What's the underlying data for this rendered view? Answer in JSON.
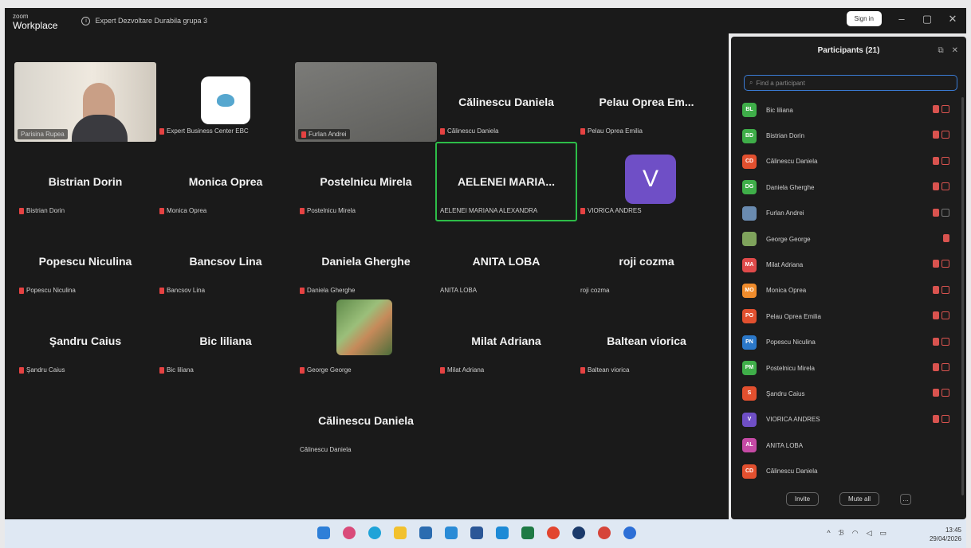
{
  "titlebar": {
    "brand_top": "zoom",
    "brand_bottom": "Workplace",
    "meeting_title": "Expert Dezvoltare Durabila grupa 3",
    "signin_label": "Sign in"
  },
  "tiles": [
    {
      "id": "t1",
      "label": "Parisina Rupea",
      "kind": "video"
    },
    {
      "id": "t2",
      "label": "Expert Business Center EBC",
      "kind": "logo"
    },
    {
      "id": "t3",
      "label": "Furlan Andrei",
      "kind": "video-gray"
    },
    {
      "id": "t4",
      "label": "Călinescu Daniela",
      "name": "Călinescu Daniela"
    },
    {
      "id": "t5",
      "label": "Pelau Oprea Emilia",
      "name": "Pelau Oprea Em..."
    },
    {
      "id": "t6",
      "label": "Bistrian Dorin",
      "name": "Bistrian Dorin"
    },
    {
      "id": "t7",
      "label": "Monica Oprea",
      "name": "Monica Oprea"
    },
    {
      "id": "t8",
      "label": "Postelnicu Mirela",
      "name": "Postelnicu Mirela"
    },
    {
      "id": "t9",
      "label": "AELENEI MARIANA ALEXANDRA",
      "name": "AELENEI MARIA..."
    },
    {
      "id": "t10",
      "label": "VIORICA ANDRES",
      "avatar": "V"
    },
    {
      "id": "t11",
      "label": "Popescu Niculina",
      "name": "Popescu Niculina"
    },
    {
      "id": "t12",
      "label": "Bancsov Lina",
      "name": "Bancsov Lina"
    },
    {
      "id": "t13",
      "label": "Daniela Gherghe",
      "name": "Daniela Gherghe"
    },
    {
      "id": "t14",
      "label": "ANITA LOBA",
      "name": "ANITA LOBA"
    },
    {
      "id": "t15",
      "label": "roji cozma",
      "name": "roji cozma"
    },
    {
      "id": "t16",
      "label": "Şandru Caius",
      "name": "Şandru Caius"
    },
    {
      "id": "t17",
      "label": "Bic liliana",
      "name": "Bic liliana"
    },
    {
      "id": "t18",
      "label": "George George",
      "kind": "photo"
    },
    {
      "id": "t19",
      "label": "Milat Adriana",
      "name": "Milat Adriana"
    },
    {
      "id": "t20",
      "label": "Baltean viorica",
      "name": "Baltean viorica"
    },
    {
      "id": "t21",
      "label": "Călinescu Daniela",
      "name": "Călinescu Daniela"
    }
  ],
  "panel": {
    "title": "Participants (21)",
    "search_placeholder": "Find a participant",
    "participants": [
      {
        "initials": "BL",
        "name": "Bic liliana",
        "color": "#3fae49"
      },
      {
        "initials": "BD",
        "name": "Bistrian Dorin",
        "color": "#3fae49"
      },
      {
        "initials": "CD",
        "name": "Călinescu Daniela",
        "color": "#e2502f"
      },
      {
        "initials": "DG",
        "name": "Daniela Gherghe",
        "color": "#3fae49"
      },
      {
        "initials": "",
        "name": "Furlan Andrei",
        "color": "#6a8bb0"
      },
      {
        "initials": "",
        "name": "George George",
        "color": "#7fa35c"
      },
      {
        "initials": "MA",
        "name": "Milat Adriana",
        "color": "#e04a4a"
      },
      {
        "initials": "MO",
        "name": "Monica Oprea",
        "color": "#f08c2c"
      },
      {
        "initials": "PO",
        "name": "Pelau Oprea Emilia",
        "color": "#e2502f"
      },
      {
        "initials": "PN",
        "name": "Popescu Niculina",
        "color": "#2b78c9"
      },
      {
        "initials": "PM",
        "name": "Postelnicu Mirela",
        "color": "#3fae49"
      },
      {
        "initials": "S",
        "name": "Şandru Caius",
        "color": "#e2502f"
      },
      {
        "initials": "V",
        "name": "VIORICA ANDRES",
        "color": "#6f4fc6"
      },
      {
        "initials": "AL",
        "name": "ANITA LOBA",
        "color": "#c64aa5"
      },
      {
        "initials": "CD",
        "name": "Călinescu Daniela",
        "color": "#e2502f"
      }
    ],
    "invite_label": "Invite",
    "muteall_label": "Mute all"
  },
  "clock": {
    "time": "13:45",
    "date": "29/04/2026"
  }
}
